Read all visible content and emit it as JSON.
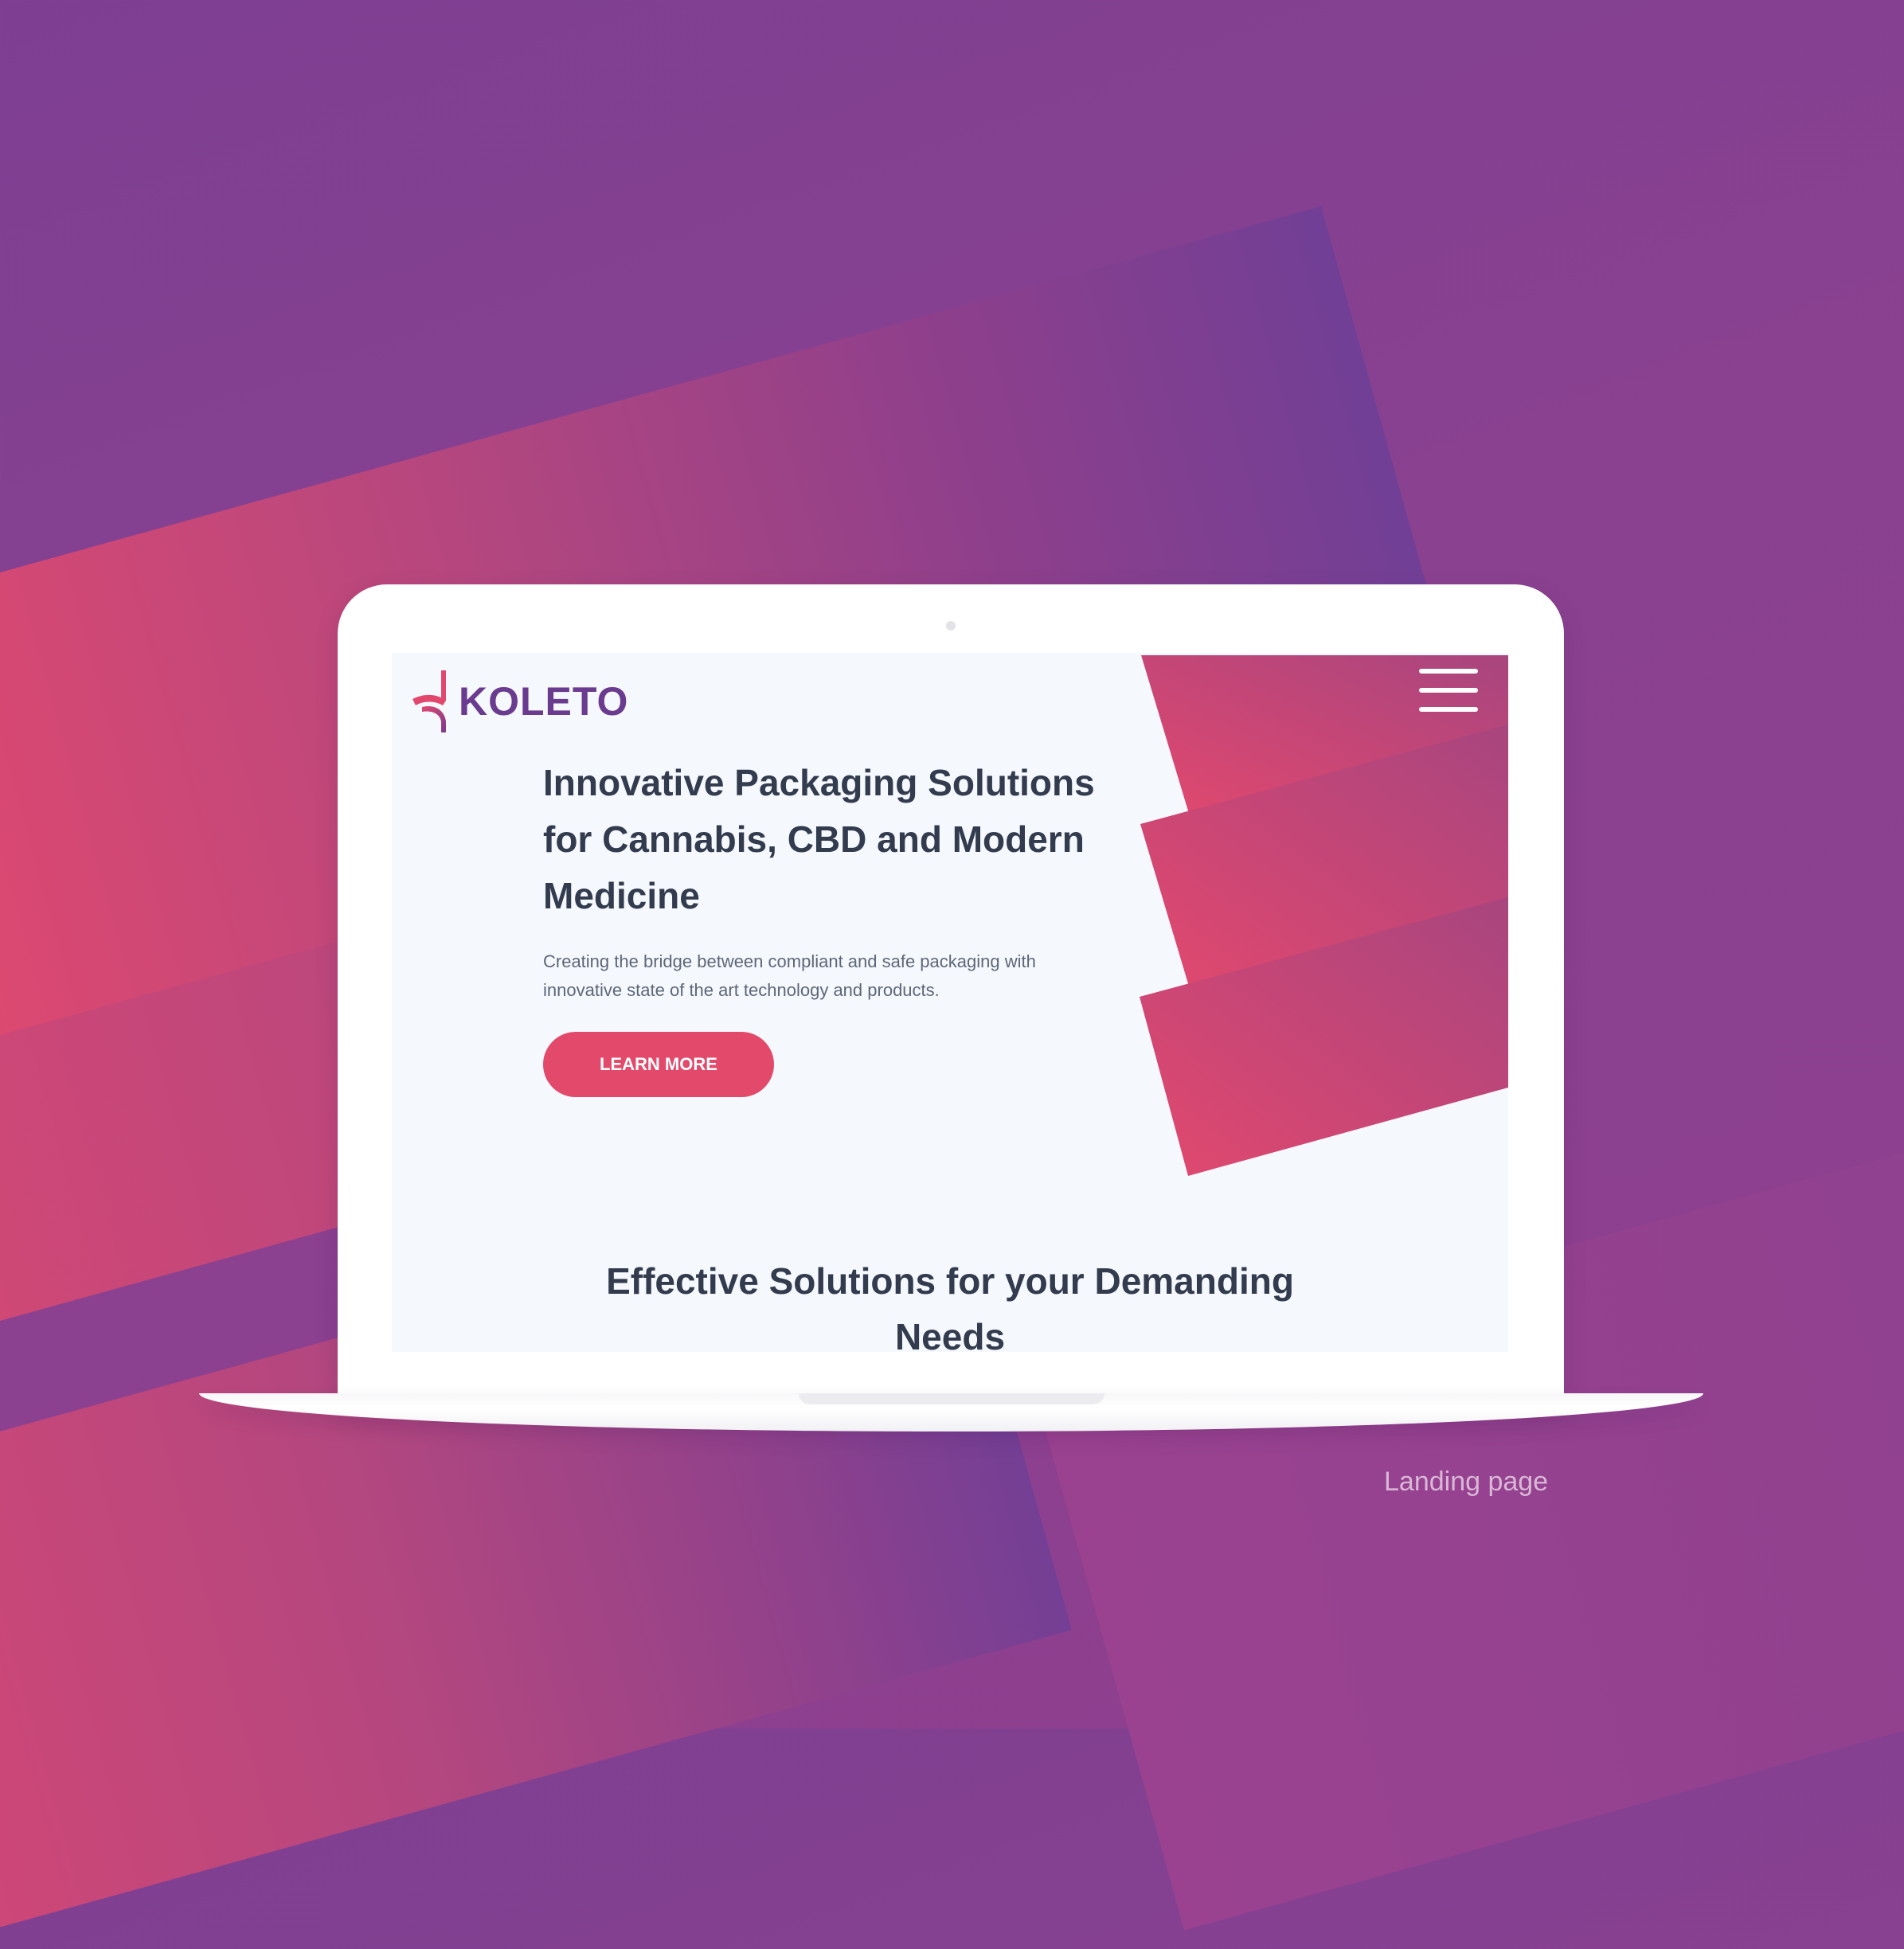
{
  "brand": {
    "name": "KOLETO"
  },
  "hero": {
    "title": "Innovative Packaging Solutions for Cannabis, CBD and Modern Medicine",
    "subtitle": "Creating the bridge between compliant and safe packaging with innovative state of the art technology and products.",
    "cta_label": "LEARN MORE"
  },
  "section": {
    "title": "Effective Solutions for your Demanding Needs"
  },
  "caption": "Landing page",
  "icons": {
    "menu": "hamburger-menu-icon",
    "logo": "koleto-logo-mark"
  },
  "colors": {
    "accent": "#e2496b",
    "brand": "#6a3b8e",
    "heading": "#333c4e",
    "background": "#8a4190"
  }
}
